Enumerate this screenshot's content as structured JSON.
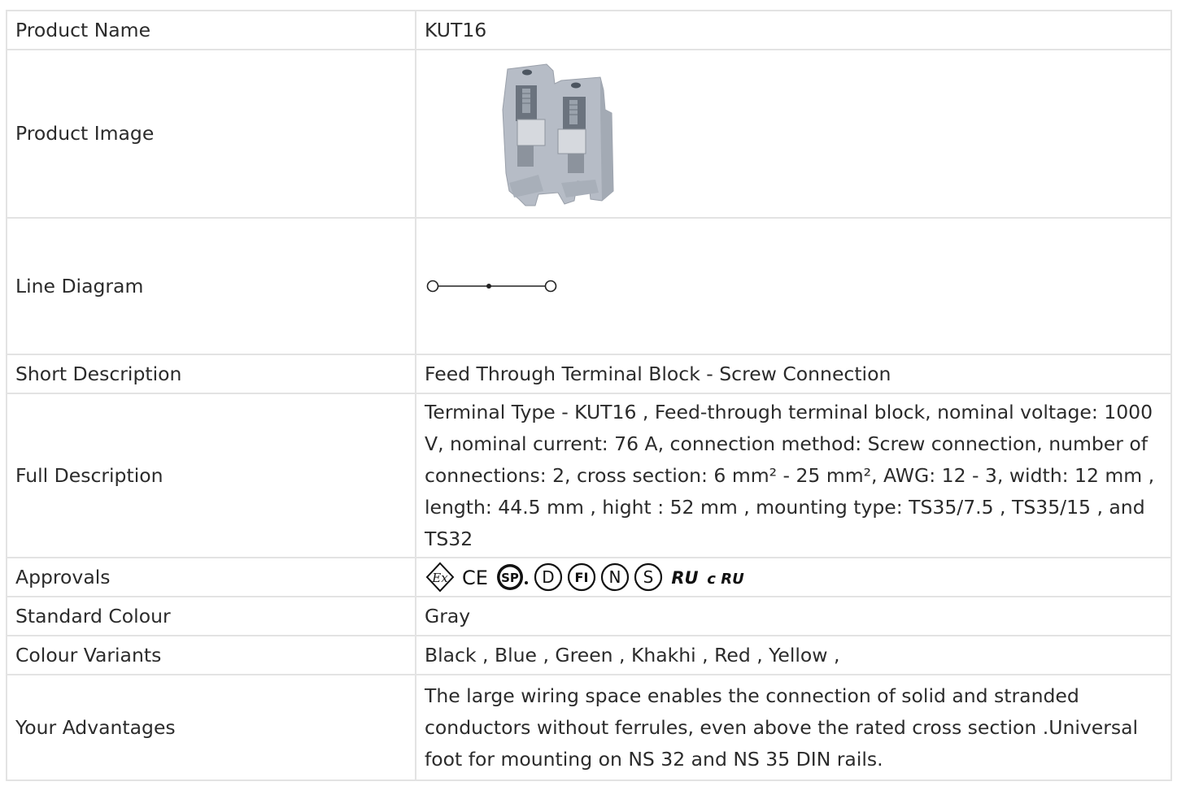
{
  "rows": {
    "product_name": {
      "label": "Product Name",
      "value": "KUT16"
    },
    "product_image": {
      "label": "Product Image"
    },
    "line_diagram": {
      "label": "Line Diagram"
    },
    "short_description": {
      "label": "Short Description",
      "value": "Feed Through Terminal Block - Screw Connection"
    },
    "full_description": {
      "label": "Full Description",
      "value": "Terminal Type - KUT16 , Feed-through terminal block, nominal voltage: 1000 V, nominal current: 76 A, connection method: Screw connection, number of connections: 2, cross section: 6 mm² - 25 mm², AWG: 12 - 3, width: 12 mm , length: 44.5 mm , hight : 52 mm , mounting type: TS35/7.5 , TS35/15 , and TS32"
    },
    "approvals": {
      "label": "Approvals",
      "icons": [
        "atex-ex-icon",
        "ce-mark-icon",
        "csa-icon",
        "demko-d-icon",
        "fimko-fi-icon",
        "nemko-n-icon",
        "semko-s-icon",
        "ul-recognized-icon",
        "cul-recognized-icon"
      ],
      "icon_text": {
        "ex": "Ex",
        "ce": "CE",
        "csa": "SP",
        "d": "D",
        "fi": "FI",
        "n": "N",
        "s": "S",
        "ul": "RU",
        "cul": "c RU"
      }
    },
    "standard_colour": {
      "label": "Standard Colour",
      "value": "Gray"
    },
    "colour_variants": {
      "label": "Colour Variants",
      "value": "Black , Blue , Green , Khakhi , Red , Yellow ,"
    },
    "advantages": {
      "label": "Your Advantages",
      "value": "The large wiring space enables the connection of solid and stranded conductors without ferrules, even above the rated cross section .Universal foot for mounting on NS 32 and NS 35 DIN rails."
    }
  },
  "colors": {
    "border": "#e3e3e3",
    "text": "#2b2b2b",
    "product_gray": "#b4bac4"
  }
}
